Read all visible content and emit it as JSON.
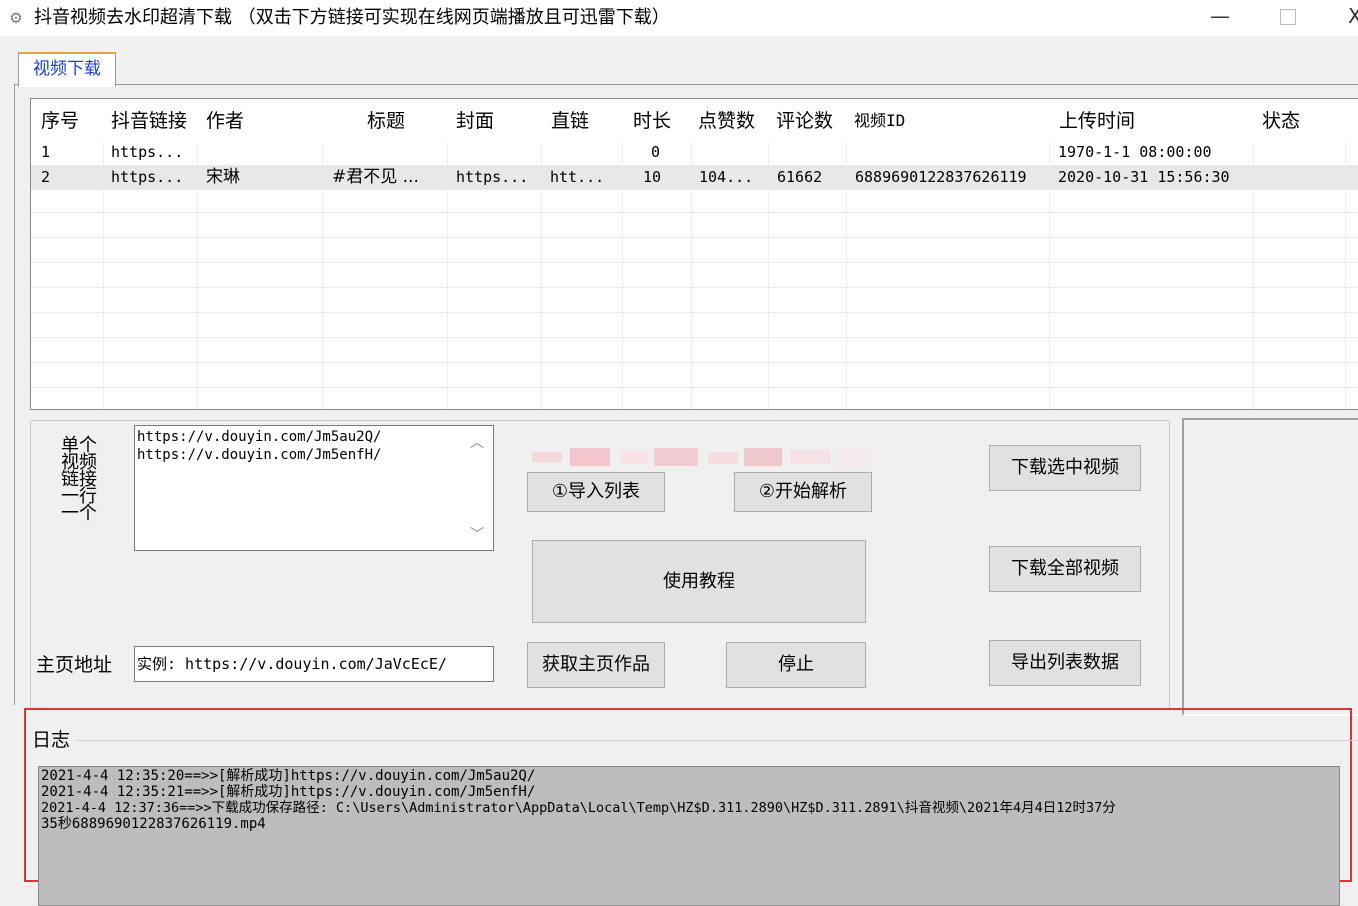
{
  "window": {
    "title": "抖音视频去水印超清下载 （双击下方链接可实现在线网页端播放且可迅雷下载）",
    "icon": "gear-icon",
    "minimize": "—",
    "close": "X"
  },
  "tabs": [
    "视频下载"
  ],
  "table": {
    "headers": [
      "序号",
      "抖音链接",
      "作者",
      "标题",
      "封面",
      "直链",
      "时长",
      "点赞数",
      "评论数",
      "视频ID",
      "上传时间",
      "状态"
    ],
    "rows": [
      [
        "1",
        "https...",
        "",
        "",
        "",
        "",
        "0",
        "",
        "",
        "",
        "1970-1-1 08:00:00",
        ""
      ],
      [
        "2",
        "https...",
        "宋琳",
        "#君不见 ...",
        "https...",
        "htt...",
        "10",
        "104...",
        "61662",
        "6889690122837626119",
        "2020-10-31 15:56:30",
        ""
      ]
    ]
  },
  "single_video": {
    "label_lines": [
      "单个",
      "视频",
      "链接",
      "一行",
      "一个"
    ],
    "lines": [
      "https://v.douyin.com/Jm5au2Q/",
      "https://v.douyin.com/Jm5enfH/"
    ]
  },
  "buttons": {
    "import_list": "①导入列表",
    "start_parse": "②开始解析",
    "tutorial": "使用教程",
    "download_selected": "下载选中视频",
    "download_all": "下载全部视频",
    "export_list": "导出列表数据",
    "fetch_homepage": "获取主页作品",
    "stop": "停止"
  },
  "homepage": {
    "label": "主页地址",
    "value": "实例: https://v.douyin.com/JaVcEcE/"
  },
  "log": {
    "label": "日志",
    "lines": [
      "2021-4-4 12:35:20==>>[解析成功]https://v.douyin.com/Jm5au2Q/",
      "2021-4-4 12:35:21==>>[解析成功]https://v.douyin.com/Jm5enfH/",
      "2021-4-4 12:37:36==>>下载成功保存路径: C:\\Users\\Administrator\\AppData\\Local\\Temp\\HZ$D.311.2890\\HZ$D.311.2891\\抖音视频\\2021年4月4日12时37分",
      "35秒6889690122837626119.mp4"
    ]
  },
  "colors": {
    "highlight_border": "#e0303a",
    "tab_accent": "#e8a33d",
    "tab_text": "#1a3fd6",
    "log_bg": "#bdbdbd"
  }
}
